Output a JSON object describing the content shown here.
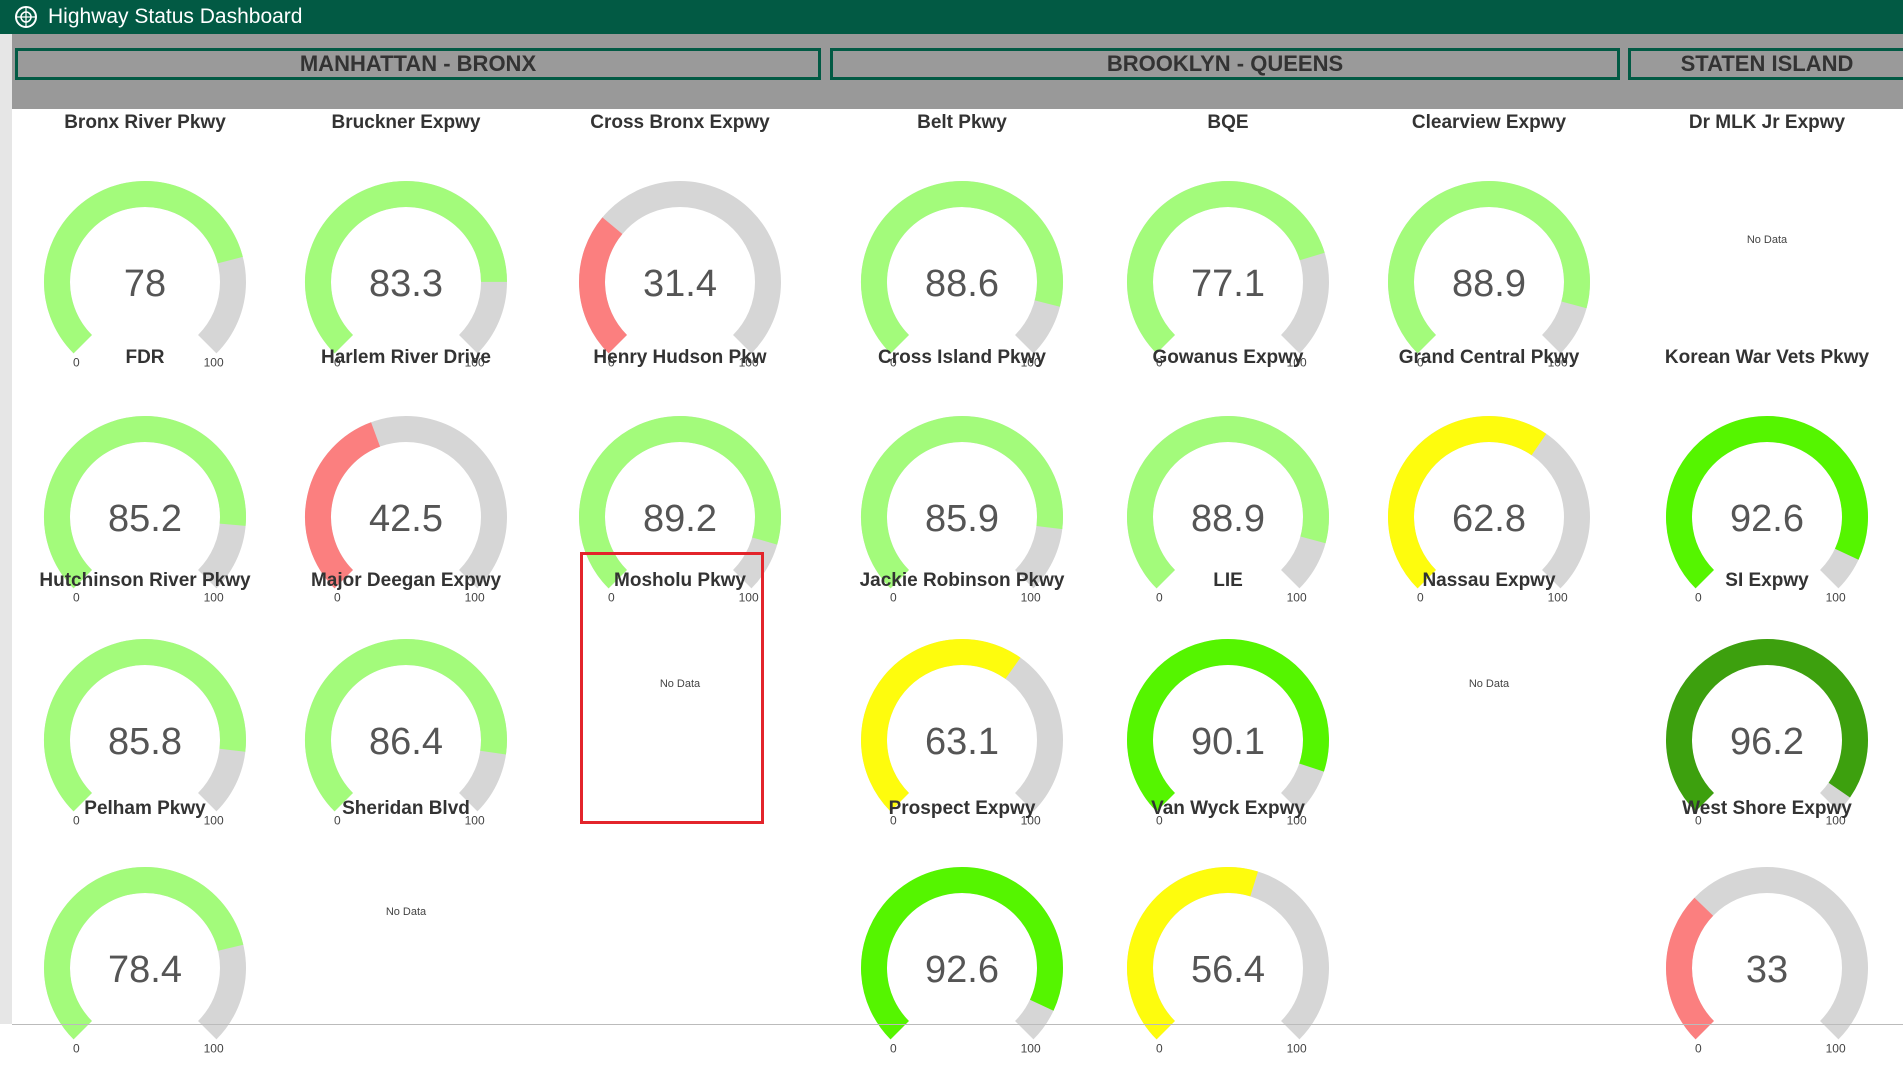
{
  "window": {
    "title": "Highway Status Dashboard",
    "icon": "app-logo-icon"
  },
  "sections": [
    {
      "id": "manhattan-bronx",
      "label": "MANHATTAN - BRONX"
    },
    {
      "id": "brooklyn-queens",
      "label": "BROOKLYN - QUEENS"
    },
    {
      "id": "staten-island",
      "label": "STATEN ISLAND"
    }
  ],
  "gauge_scale": {
    "min": "0",
    "max": "100"
  },
  "no_data_text": "No Data",
  "colors": {
    "titlebar": "#025a44",
    "track": "#d6d6d6",
    "light_green": "#a3fb7b",
    "bright_green": "#55f500",
    "dark_green": "#3da00e",
    "yellow": "#fefc0d",
    "red": "#fb7f7f",
    "highlight": "#e3242b"
  },
  "gauges": [
    {
      "name": "Bronx River Pkwy",
      "value": "78",
      "color": "#a3fb7b"
    },
    {
      "name": "Bruckner Expwy",
      "value": "83.3",
      "color": "#a3fb7b"
    },
    {
      "name": "Cross Bronx Expwy",
      "value": "31.4",
      "color": "#fb7f7f"
    },
    {
      "name": "FDR",
      "value": "85.2",
      "color": "#a3fb7b"
    },
    {
      "name": "Harlem River Drive",
      "value": "42.5",
      "color": "#fb7f7f"
    },
    {
      "name": "Henry Hudson Pkw",
      "value": "89.2",
      "color": "#a3fb7b"
    },
    {
      "name": "Hutchinson River Pkwy",
      "value": "85.8",
      "color": "#a3fb7b"
    },
    {
      "name": "Major Deegan Expwy",
      "value": "86.4",
      "color": "#a3fb7b"
    },
    {
      "name": "Mosholu Pkwy",
      "value": null,
      "highlighted": true
    },
    {
      "name": "Pelham Pkwy",
      "value": "78.4",
      "color": "#a3fb7b"
    },
    {
      "name": "Sheridan Blvd",
      "value": null
    },
    {
      "name": "Belt Pkwy",
      "value": "88.6",
      "color": "#a3fb7b"
    },
    {
      "name": "BQE",
      "value": "77.1",
      "color": "#a3fb7b"
    },
    {
      "name": "Clearview Expwy",
      "value": "88.9",
      "color": "#a3fb7b"
    },
    {
      "name": "Cross Island Pkwy",
      "value": "85.9",
      "color": "#a3fb7b"
    },
    {
      "name": "Gowanus Expwy",
      "value": "88.9",
      "color": "#a3fb7b"
    },
    {
      "name": "Grand Central Pkwy",
      "value": "62.8",
      "color": "#fefc0d"
    },
    {
      "name": "Jackie Robinson Pkwy",
      "value": "63.1",
      "color": "#fefc0d"
    },
    {
      "name": "LIE",
      "value": "90.1",
      "color": "#55f500"
    },
    {
      "name": "Nassau Expwy",
      "value": null
    },
    {
      "name": "Prospect Expwy",
      "value": "92.6",
      "color": "#55f500"
    },
    {
      "name": "Van Wyck Expwy",
      "value": "56.4",
      "color": "#fefc0d"
    },
    {
      "name": "Dr MLK Jr Expwy",
      "value": null
    },
    {
      "name": "Korean War Vets Pkwy",
      "value": "92.6",
      "color": "#55f500"
    },
    {
      "name": "SI Expwy",
      "value": "96.2",
      "color": "#3da00e"
    },
    {
      "name": "West Shore Expwy",
      "value": "33",
      "color": "#fb7f7f"
    }
  ]
}
